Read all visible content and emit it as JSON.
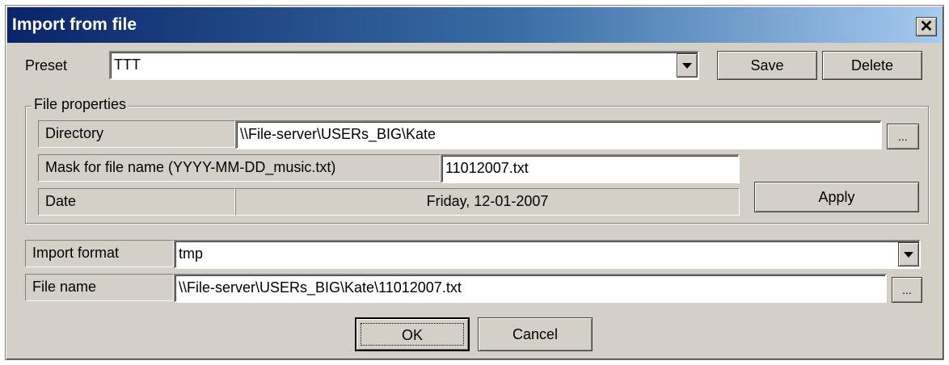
{
  "window": {
    "title": "Import from file"
  },
  "preset": {
    "label": "Preset",
    "value": "TTT",
    "save_label": "Save",
    "delete_label": "Delete"
  },
  "file_properties": {
    "group_title": "File properties",
    "directory_label": "Directory",
    "directory_value": "\\\\File-server\\USERs_BIG\\Kate",
    "browse_label": "...",
    "mask_label": "Mask for file name (YYYY-MM-DD_music.txt)",
    "mask_value": "11012007.txt",
    "date_label": "Date",
    "date_value": "Friday,  12-01-2007",
    "apply_label": "Apply"
  },
  "import_format": {
    "label": "Import format",
    "value": "tmp"
  },
  "file_name": {
    "label": "File name",
    "value": "\\\\File-server\\USERs_BIG\\Kate\\11012007.txt",
    "browse_label": "..."
  },
  "buttons": {
    "ok_label": "OK",
    "cancel_label": "Cancel"
  },
  "icons": {
    "close": "close-icon",
    "dropdown": "chevron-down-icon"
  }
}
